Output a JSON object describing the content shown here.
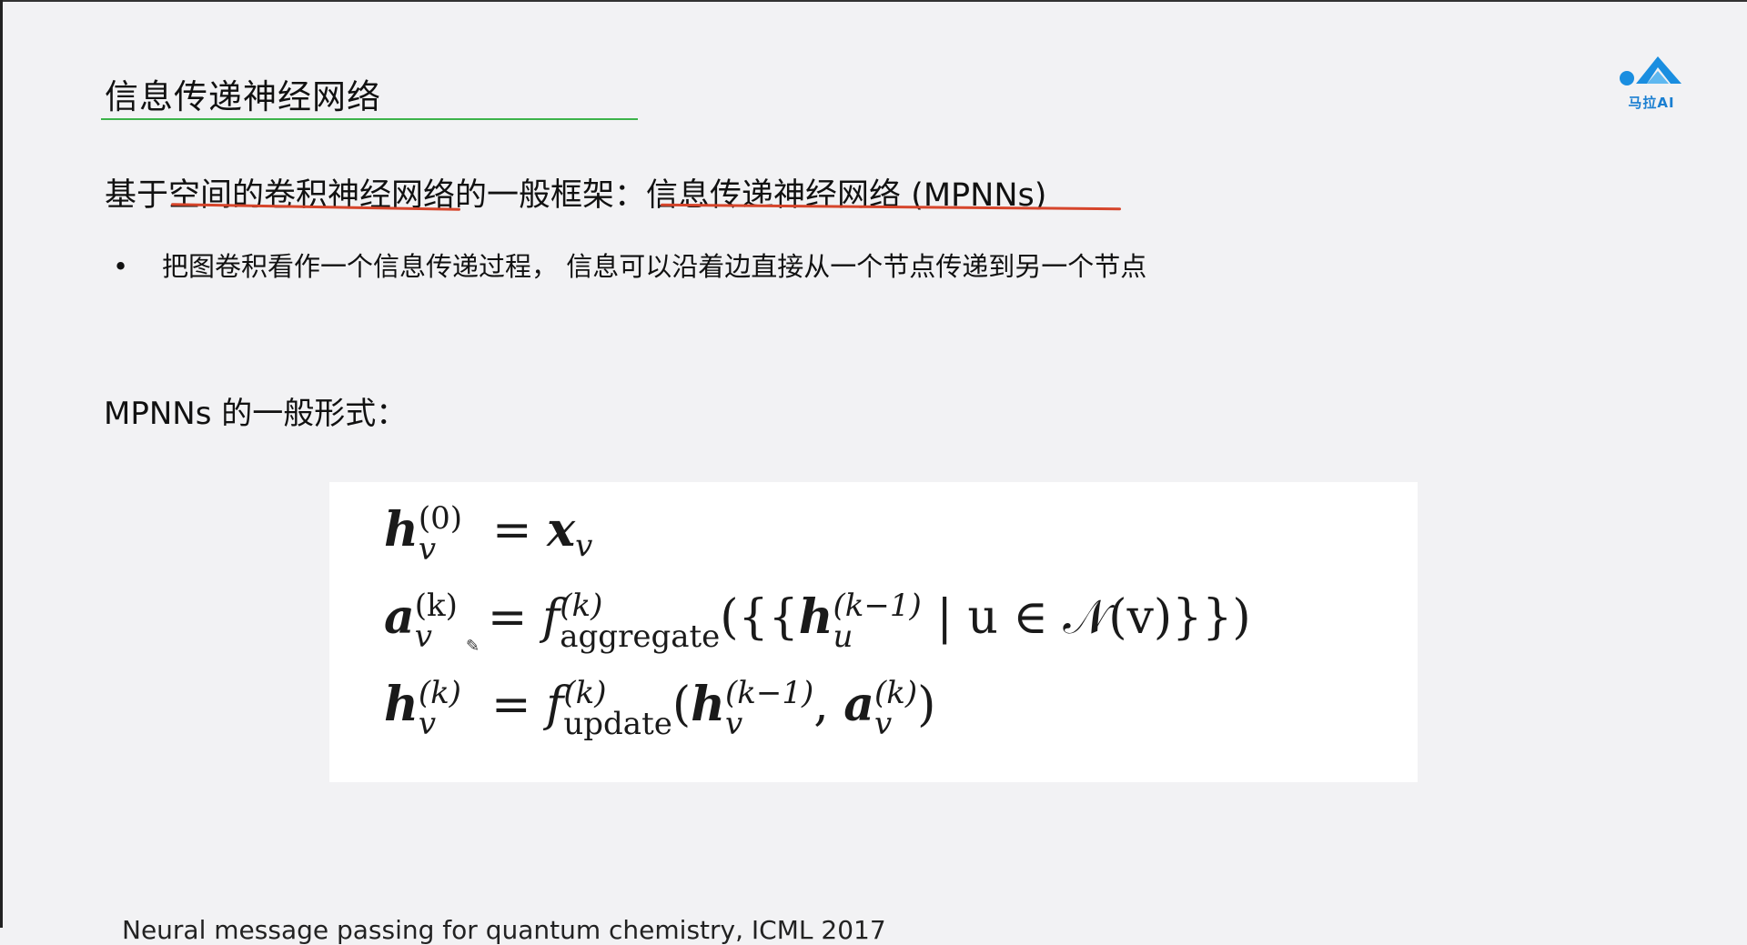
{
  "slide": {
    "title": "信息传递神经网络",
    "heading_prefix": "基于",
    "heading_underlined_1": "空间的卷积神经网络",
    "heading_middle": "的一般框架：",
    "heading_underlined_2": "信息传递神经网络 (MPNNs)",
    "bullet": "把图卷积看作一个信息传递过程， 信息可以沿着边直接从一个节点传递到另一个节点",
    "form_heading": "MPNNs 的一般形式："
  },
  "logo": {
    "text": "马拉AI",
    "color": "#1a7fd1"
  },
  "formula": {
    "eq1": {
      "lhs": "h",
      "lhs_sub": "v",
      "lhs_sup": "(0)",
      "rhs": "x",
      "rhs_sub": "v"
    },
    "eq2": {
      "lhs": "a",
      "lhs_sub": "v",
      "lhs_sup": "(k)",
      "func": "f",
      "func_sup": "(k)",
      "func_sub": "aggregate",
      "arg_open": "({{",
      "arg_h": "h",
      "arg_h_sub": "u",
      "arg_h_sup": "(k−1)",
      "arg_rest": " | u ∈ 𝒩(v)}})"
    },
    "eq3": {
      "lhs": "h",
      "lhs_sub": "v",
      "lhs_sup": "(k)",
      "func": "f",
      "func_sup": "(k)",
      "func_sub": "update",
      "arg_h": "h",
      "arg_h_sub": "v",
      "arg_h_sup": "(k−1)",
      "arg_a": "a",
      "arg_a_sub": "v",
      "arg_a_sup": "(k)"
    }
  },
  "footer": {
    "text": "Neural message passing for quantum chemistry, ICML 2017"
  },
  "colors": {
    "title_rule": "#3db34a",
    "annotation": "#d6452b",
    "background": "#f2f2f4"
  }
}
